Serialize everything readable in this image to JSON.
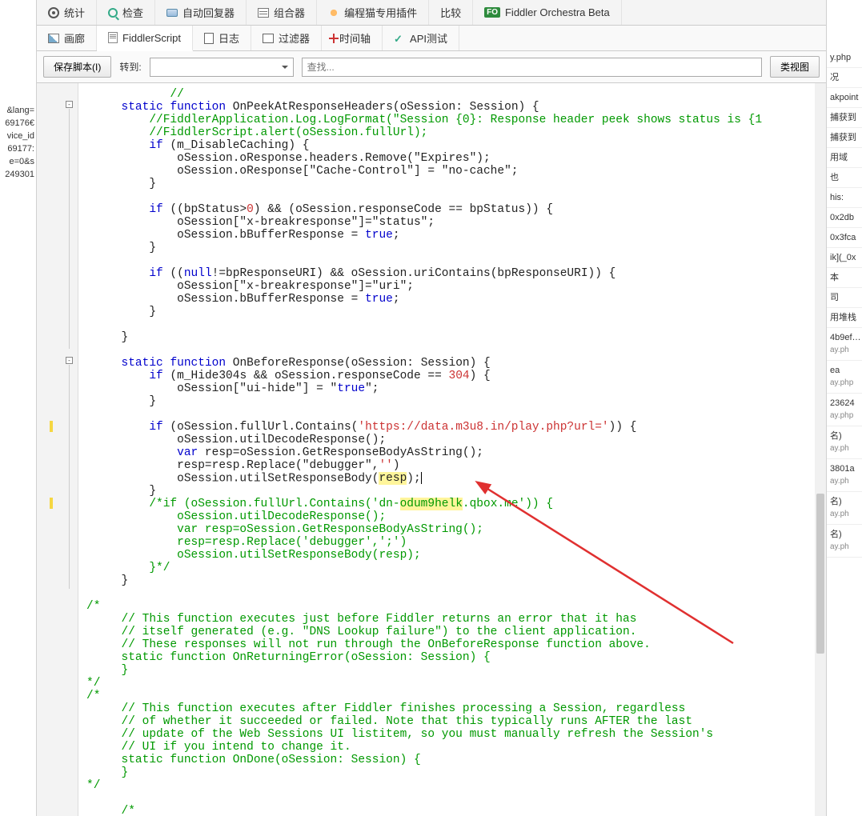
{
  "toolbar_top": {
    "items": [
      "统计",
      "检查",
      "自动回复器",
      "组合器",
      "编程猫专用插件",
      "比较"
    ],
    "orchestra": "Fiddler Orchestra Beta"
  },
  "tabs2": {
    "items": [
      "画廊",
      "FiddlerScript",
      "日志",
      "过滤器",
      "时间轴",
      "API测试"
    ],
    "active_index": 1
  },
  "script_bar": {
    "save_btn": "保存脚本(I)",
    "goto_label": "转到:",
    "find_placeholder": "查找...",
    "classview_btn": "类视图"
  },
  "left_fragments": [
    "&lang=",
    "",
    "69176€",
    "vice_id",
    "69177:",
    "e=0&s",
    "249301"
  ],
  "right_fragments": [
    {
      "a": "y.php"
    },
    {
      "a": "况"
    },
    {
      "a": "akpoint"
    },
    {
      "a": "捕获到",
      "b": ""
    },
    {
      "a": "捕获到",
      "b": ""
    },
    {
      "a": "用域"
    },
    {
      "a": "也"
    },
    {
      "a": "his:"
    },
    {
      "a": "0x2db",
      "b": ""
    },
    {
      "a": "0x3fca",
      "b": ""
    },
    {
      "a": "ik](_0x"
    },
    {
      "a": "本"
    },
    {
      "a": "司"
    },
    {
      "a": "用堆栈"
    },
    {
      "a": "4b9ef…",
      "b": "ay.ph"
    },
    {
      "a": "ea",
      "b": "ay.php"
    },
    {
      "a": "23624",
      "b": "ay.php"
    },
    {
      "a": "名)",
      "b": "ay.ph"
    },
    {
      "a": "3801a",
      "b": "ay.ph"
    },
    {
      "a": "名)",
      "b": "ay.ph"
    },
    {
      "a": "名)",
      "b": "ay.ph"
    }
  ],
  "code_lines": [
    "            //",
    "     static function OnPeekAtResponseHeaders(oSession: Session) {",
    "         //FiddlerApplication.Log.LogFormat(\"Session {0}: Response header peek shows status is {1",
    "         //FiddlerScript.alert(oSession.fullUrl);",
    "         if (m_DisableCaching) {",
    "             oSession.oResponse.headers.Remove(\"Expires\");",
    "             oSession.oResponse[\"Cache-Control\"] = \"no-cache\";",
    "         }",
    "",
    "         if ((bpStatus>0) && (oSession.responseCode == bpStatus)) {",
    "             oSession[\"x-breakresponse\"]=\"status\";",
    "             oSession.bBufferResponse = true;",
    "         }",
    "",
    "         if ((null!=bpResponseURI) && oSession.uriContains(bpResponseURI)) {",
    "             oSession[\"x-breakresponse\"]=\"uri\";",
    "             oSession.bBufferResponse = true;",
    "         }",
    "",
    "     }",
    "",
    "     static function OnBeforeResponse(oSession: Session) {",
    "         if (m_Hide304s && oSession.responseCode == 304) {",
    "             oSession[\"ui-hide\"] = \"true\";",
    "         }",
    "",
    "         if (oSession.fullUrl.Contains('https://data.m3u8.in/play.php?url=')) {",
    "             oSession.utilDecodeResponse();",
    "             var resp=oSession.GetResponseBodyAsString();",
    "             resp=resp.Replace(\"debugger\",'')",
    "             oSession.utilSetResponseBody(resp);| ",
    "         }",
    "         /*if (oSession.fullUrl.Contains('dn-odum9helk.qbox.me')) {",
    "             oSession.utilDecodeResponse();",
    "             var resp=oSession.GetResponseBodyAsString();",
    "             resp=resp.Replace('debugger',';')",
    "             oSession.utilSetResponseBody(resp);",
    "         }*/",
    "     }",
    "",
    "/*",
    "     // This function executes just before Fiddler returns an error that it has",
    "     // itself generated (e.g. \"DNS Lookup failure\") to the client application.",
    "     // These responses will not run through the OnBeforeResponse function above.",
    "     static function OnReturningError(oSession: Session) {",
    "     }",
    "*/",
    "/*",
    "     // This function executes after Fiddler finishes processing a Session, regardless",
    "     // of whether it succeeded or failed. Note that this typically runs AFTER the last",
    "     // update of the Web Sessions UI listitem, so you must manually refresh the Session's",
    "     // UI if you intend to change it.",
    "     static function OnDone(oSession: Session) {",
    "     }",
    "*/",
    "",
    "     /*"
  ]
}
